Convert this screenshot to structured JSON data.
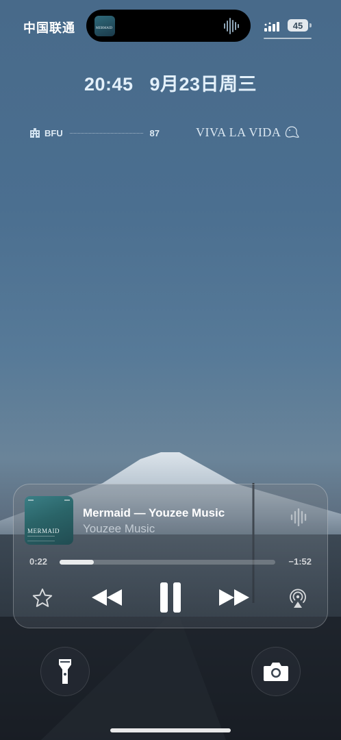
{
  "status_bar": {
    "carrier": "中国联通",
    "battery_level": "45",
    "island_album_text": "MERMAID"
  },
  "lock_screen": {
    "time": "20:45",
    "date": "9月23日周三"
  },
  "widgets": {
    "left_label": "BFU",
    "left_value": "87",
    "right_text": "VIVA LA VIDA"
  },
  "now_playing": {
    "album_title": "MERMAID",
    "track_title": "Mermaid — Youzee Music",
    "artist": "Youzee Music",
    "elapsed": "0:22",
    "remaining": "−1:52",
    "progress": 0.16
  },
  "colors": {
    "sky_top": "#486a8a",
    "ground": "#1e252d",
    "album_teal": "#2a6468",
    "time_text": "#e3f0fa"
  },
  "icons": {
    "favorite": "star-icon",
    "rewind": "backward-icon",
    "play_state": "pause-icon",
    "forward": "forward-icon",
    "output": "airplay-icon",
    "flashlight": "flashlight-icon",
    "camera": "camera-icon"
  }
}
